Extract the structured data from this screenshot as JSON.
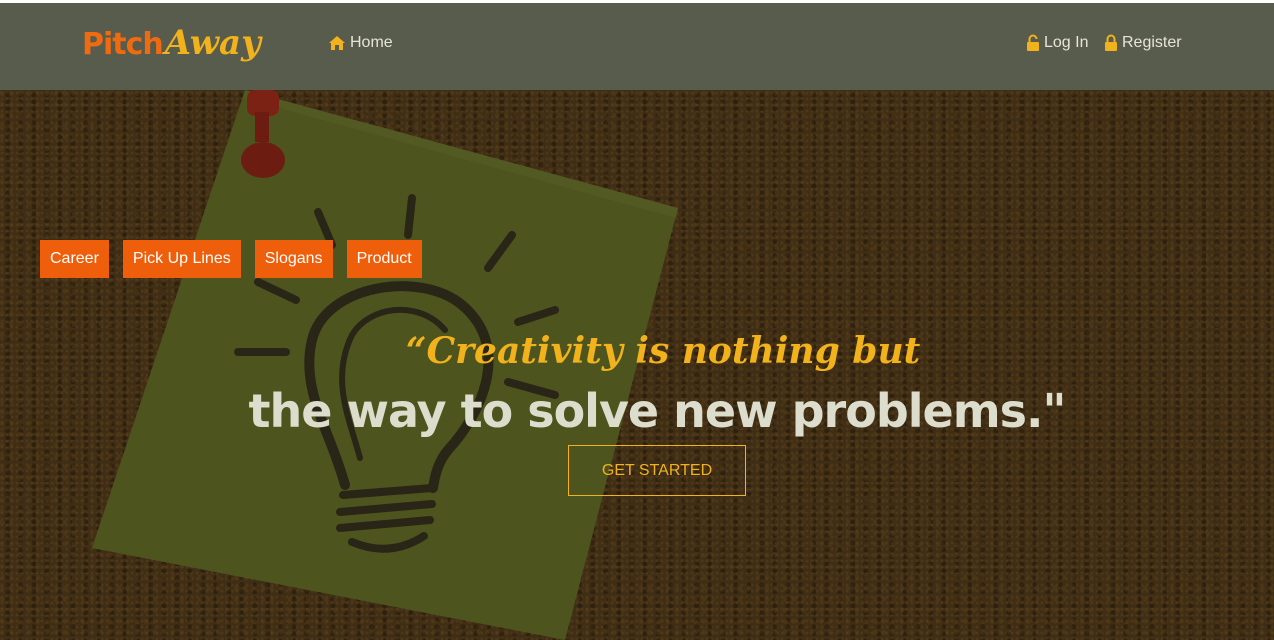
{
  "colors": {
    "navbar_bg": "#585c4d",
    "brand_orange": "#f06a0f",
    "brand_yellow": "#f2b21b",
    "category_bg": "#ef5f0b",
    "quote_yellow": "#f2b21b",
    "quote_white": "#dcddcc"
  },
  "brand": {
    "part1": "Pitch",
    "part2": "Away"
  },
  "nav": {
    "home": {
      "label": "Home",
      "icon": "home-icon"
    },
    "login": {
      "label": "Log In",
      "icon": "unlock-icon"
    },
    "register": {
      "label": "Register",
      "icon": "lock-icon"
    }
  },
  "categories": [
    "Career",
    "Pick Up Lines",
    "Slogans",
    "Product"
  ],
  "hero": {
    "quote_line1": "“Creativity is nothing but",
    "quote_line2": "the way to solve new problems.\"",
    "cta": "GET STARTED",
    "background": "corkboard-with-sticky-note-lightbulb"
  }
}
